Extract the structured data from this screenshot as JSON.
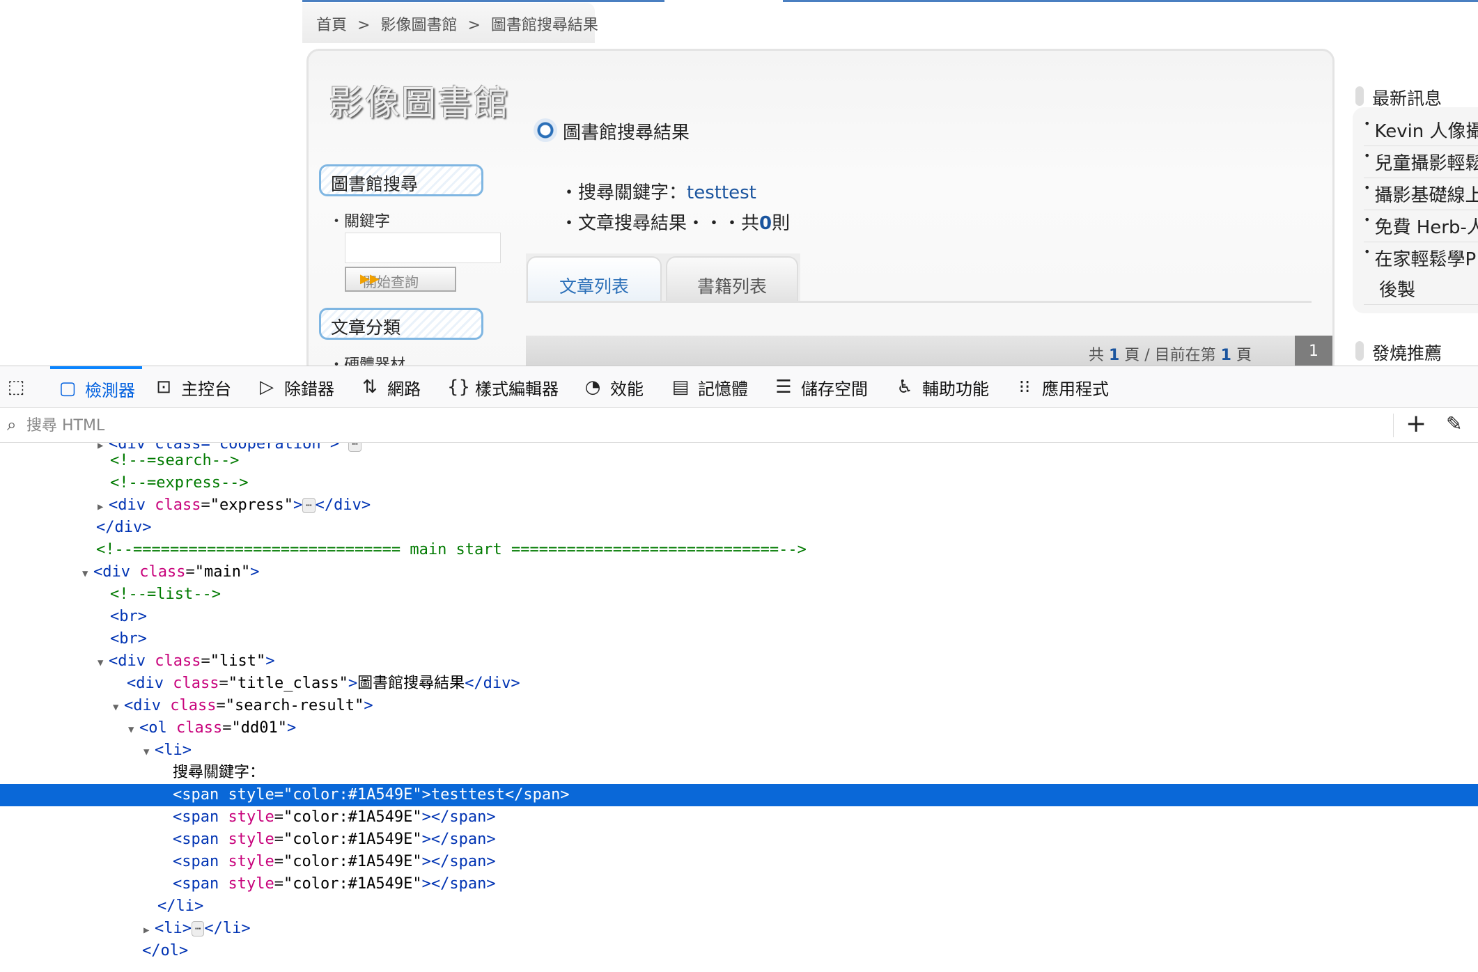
{
  "breadcrumb": [
    "首頁",
    ">",
    "影像圖書館",
    ">",
    "圖書館搜尋結果"
  ],
  "site": {
    "title": "影像圖書館",
    "sidebar_search_heading": "圖書館搜尋",
    "keyword_label": "關鍵字",
    "keyword_value": "",
    "query_button": "開始查詢",
    "category_heading": "文章分類",
    "category_item": "硬體器材"
  },
  "results": {
    "title": "圖書館搜尋結果",
    "keyword_label": "・搜尋關鍵字：",
    "keyword_value": "testtest",
    "article_label": "・文章搜尋結果・・・共",
    "article_count": "0",
    "article_unit": "則",
    "tabs": [
      "文章列表",
      "書籍列表"
    ],
    "pager_prefix": "共",
    "pager_total": "1",
    "pager_mid": "頁 / 目前在第",
    "pager_current": "1",
    "pager_suffix": "頁",
    "page_button": "1"
  },
  "right_panel": {
    "news_heading": "最新訊息",
    "news_items": [
      "Kevin 人像攝",
      "兒童攝影輕鬆",
      "攝影基礎線上",
      "免費 Herb-人",
      "在家輕鬆學P"
    ],
    "news_item_wrap": "後製",
    "recommend_heading": "發燒推薦"
  },
  "devtools": {
    "tabs": [
      {
        "label": "檢測器",
        "icon": "inspector-icon"
      },
      {
        "label": "主控台",
        "icon": "console-icon"
      },
      {
        "label": "除錯器",
        "icon": "debugger-icon"
      },
      {
        "label": "網路",
        "icon": "network-icon"
      },
      {
        "label": "樣式編輯器",
        "icon": "style-editor-icon"
      },
      {
        "label": "效能",
        "icon": "performance-icon"
      },
      {
        "label": "記憶體",
        "icon": "memory-icon"
      },
      {
        "label": "儲存空間",
        "icon": "storage-icon"
      },
      {
        "label": "輔助功能",
        "icon": "accessibility-icon"
      },
      {
        "label": "應用程式",
        "icon": "application-icon"
      }
    ],
    "active_tab": "檢測器",
    "search_placeholder": "搜尋 HTML",
    "highlight_color": "#0a68d8",
    "markup": {
      "l0": "<div class=\"cooperation\">",
      "l1": "<!--=search-->",
      "l2": "<!--=express-->",
      "l3_tag": "div",
      "l3_attr": "class",
      "l3_val": "\"express\"",
      "l4": "</div>",
      "l5": "<!--============================= main start =============================-->",
      "l6_tag": "div",
      "l6_attr": "class",
      "l6_val": "\"main\"",
      "l7": "<!--=list-->",
      "l8": "<br>",
      "l9": "<br>",
      "l10_tag": "div",
      "l10_attr": "class",
      "l10_val": "\"list\"",
      "l11_tag": "div",
      "l11_attr": "class",
      "l11_val": "\"title_class\"",
      "l11_text": "圖書館搜尋結果",
      "l12_tag": "div",
      "l12_attr": "class",
      "l12_val": "\"search-result\"",
      "l13_tag": "ol",
      "l13_attr": "class",
      "l13_val": "\"dd01\"",
      "l14": "<li>",
      "l15_text": "搜尋關鍵字：",
      "l16_attr": "style",
      "l16_val": "\"color:#1A549E\"",
      "l16_text": "testtest",
      "span_attr": "style",
      "span_val": "\"color:#1A549E\"",
      "l21": "</li>",
      "l22": "<li>",
      "l23": "</ol>"
    }
  }
}
